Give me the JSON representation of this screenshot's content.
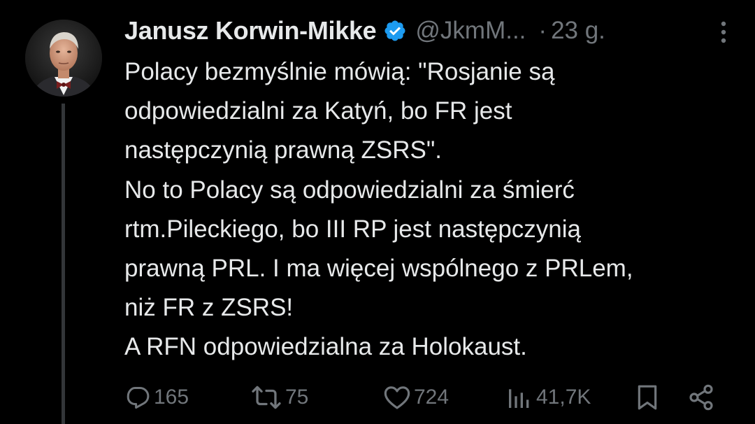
{
  "author": {
    "name": "Janusz Korwin-Mikke",
    "handle": "@JkmM...",
    "time_separator": "·",
    "time": "23 g.",
    "verified": true,
    "verified_color": "#1d9bf0"
  },
  "tweet": {
    "lines": [
      "Polacy bezmyślnie mówią: \"Rosjanie są",
      "odpowiedzialni za Katyń, bo FR jest",
      "następczynią prawną ZSRS\".",
      "No to Polacy są odpowiedzialni za śmierć",
      "rtm.Pileckiego, bo III RP jest następczynią",
      "prawną PRL. I ma więcej wspólnego z PRLem,",
      "niż FR z ZSRS!",
      "A RFN odpowiedzialna za Holokaust."
    ]
  },
  "actions": {
    "replies": "165",
    "retweets": "75",
    "likes": "724",
    "views": "41,7K"
  },
  "icons": {
    "more": "more-vertical-icon",
    "reply": "reply-icon",
    "retweet": "retweet-icon",
    "like": "heart-icon",
    "views": "views-icon",
    "bookmark": "bookmark-icon",
    "share": "share-icon"
  },
  "colors": {
    "background": "#000000",
    "text": "#e7e9ea",
    "secondary": "#71767b",
    "thread_line": "#333639"
  }
}
